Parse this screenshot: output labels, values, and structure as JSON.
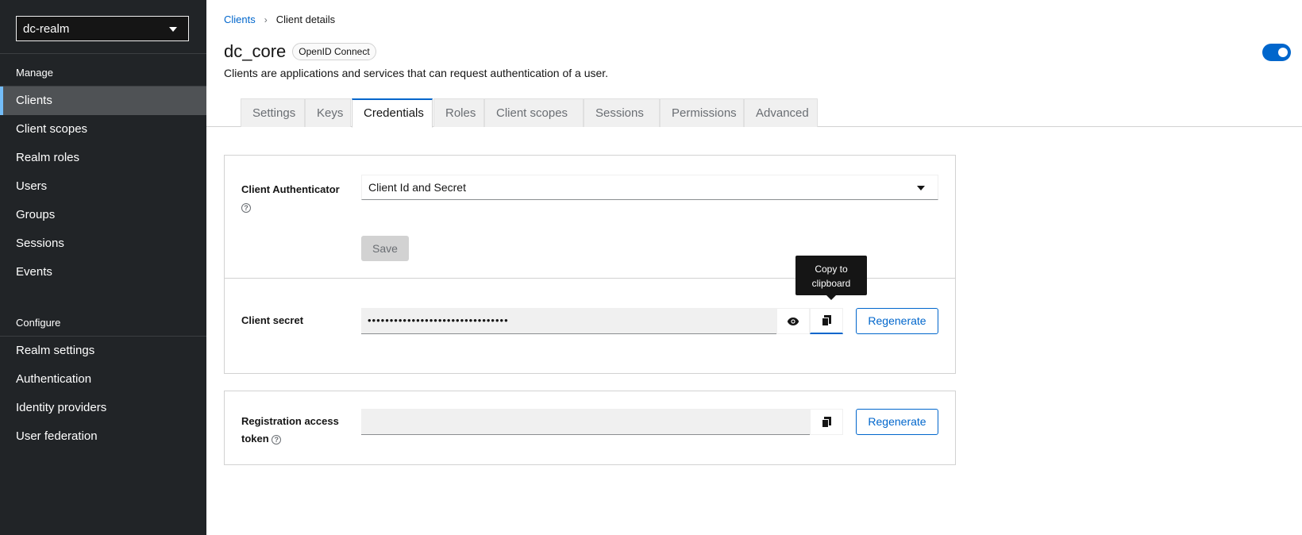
{
  "sidebar": {
    "realm": "dc-realm",
    "manage_title": "Manage",
    "manage_items": [
      {
        "label": "Clients"
      },
      {
        "label": "Client scopes"
      },
      {
        "label": "Realm roles"
      },
      {
        "label": "Users"
      },
      {
        "label": "Groups"
      },
      {
        "label": "Sessions"
      },
      {
        "label": "Events"
      }
    ],
    "configure_title": "Configure",
    "configure_items": [
      {
        "label": "Realm settings"
      },
      {
        "label": "Authentication"
      },
      {
        "label": "Identity providers"
      },
      {
        "label": "User federation"
      }
    ]
  },
  "breadcrumb": {
    "parent": "Clients",
    "current": "Client details"
  },
  "header": {
    "title": "dc_core",
    "badge": "OpenID Connect",
    "subtitle": "Clients are applications and services that can request authentication of a user.",
    "enabled": true
  },
  "tabs": [
    {
      "label": "Settings"
    },
    {
      "label": "Keys"
    },
    {
      "label": "Credentials"
    },
    {
      "label": "Roles"
    },
    {
      "label": "Client scopes"
    },
    {
      "label": "Sessions"
    },
    {
      "label": "Permissions"
    },
    {
      "label": "Advanced"
    }
  ],
  "credentials": {
    "authenticator_label": "Client Authenticator",
    "authenticator_value": "Client Id and Secret",
    "save_label": "Save",
    "secret_label": "Client secret",
    "secret_value": "••••••••••••••••••••••••••••••••",
    "tooltip": "Copy to clipboard",
    "regenerate_label": "Regenerate",
    "token_label": "Registration access token",
    "token_value": "",
    "token_regenerate_label": "Regenerate"
  },
  "colors": {
    "accent": "#0066cc",
    "sidebar_bg": "#212427",
    "active_nav_bg": "#4f5255"
  }
}
